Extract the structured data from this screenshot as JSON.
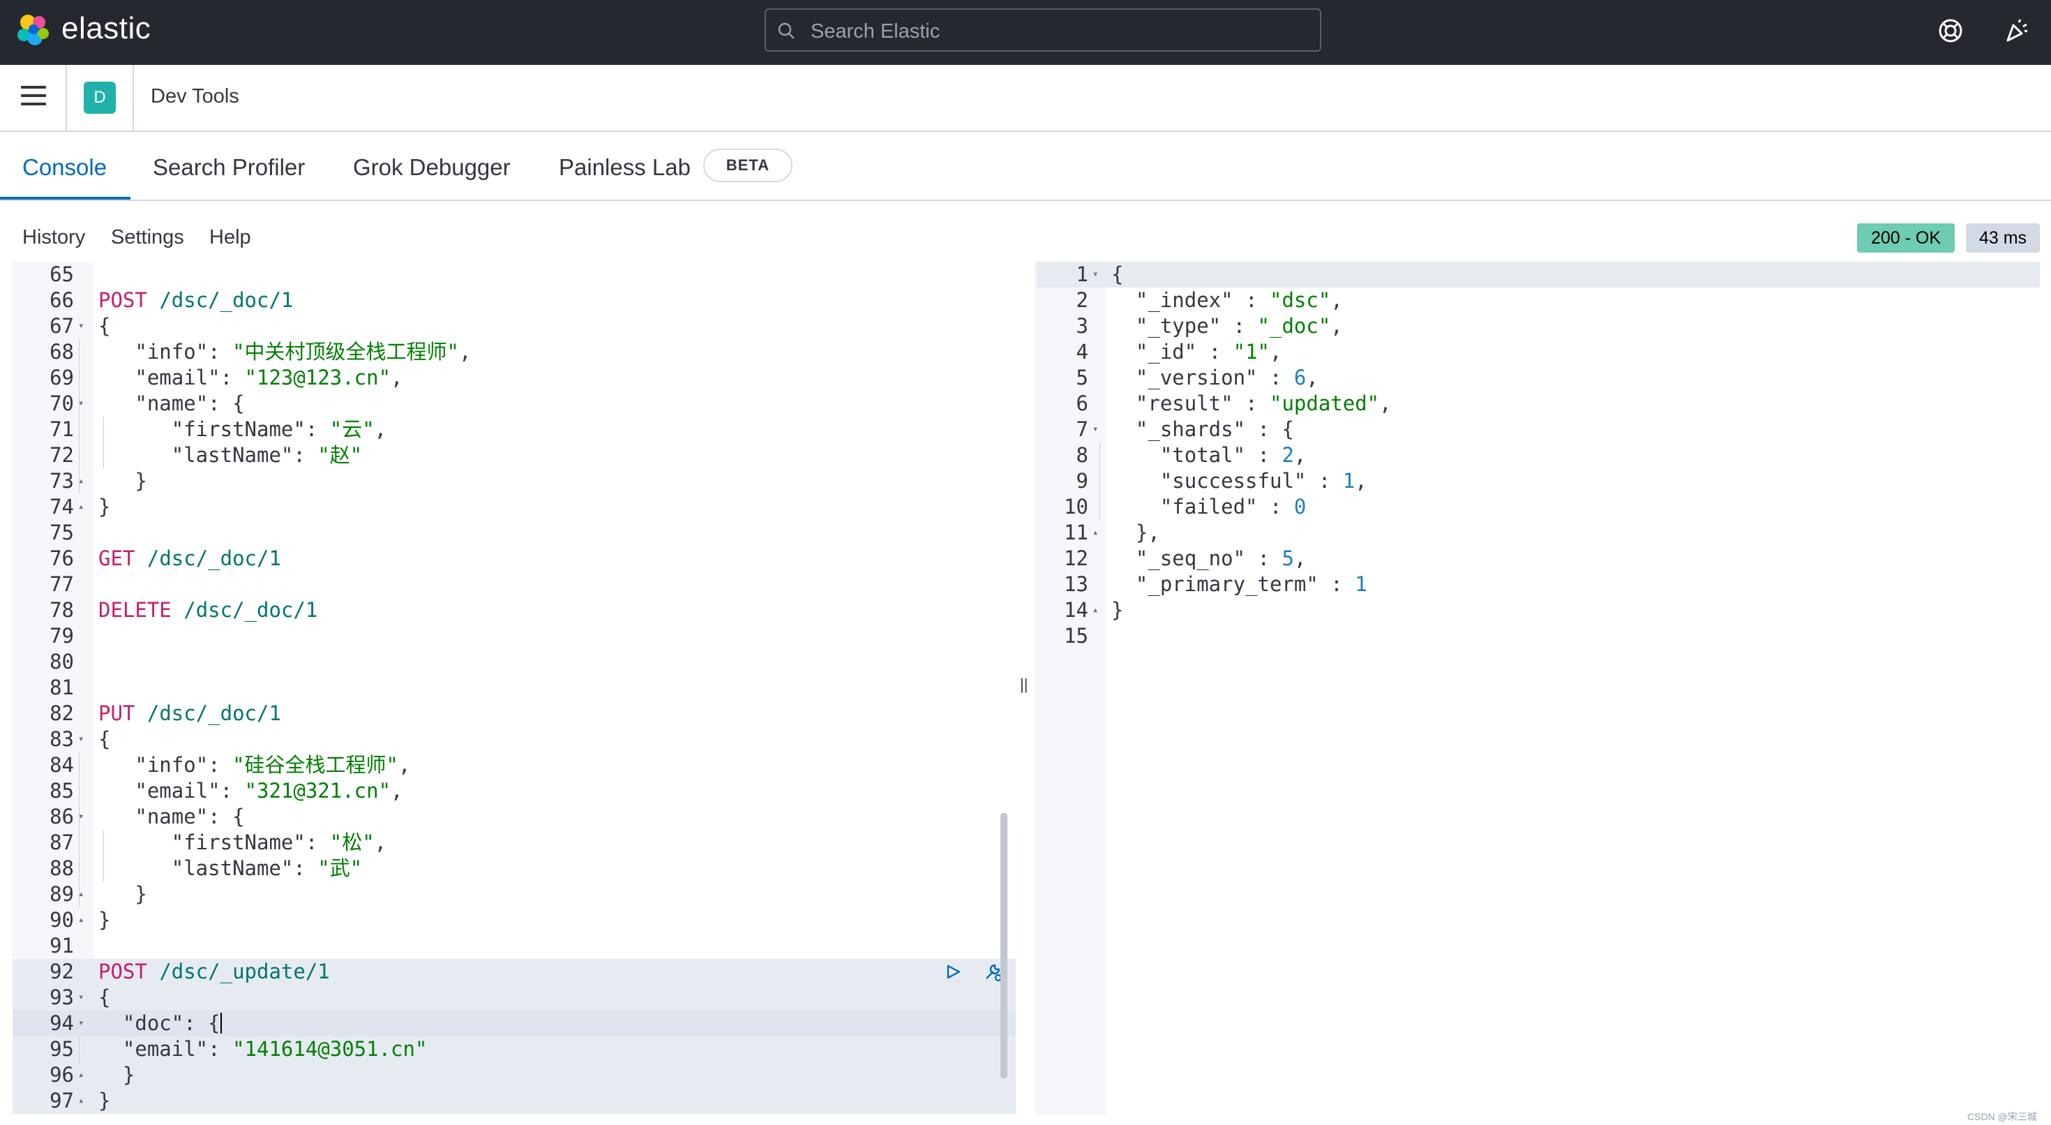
{
  "header": {
    "logo_text": "elastic",
    "search_placeholder": "Search Elastic"
  },
  "breadcrumb": {
    "space_initial": "D",
    "page": "Dev Tools"
  },
  "tabs": [
    {
      "label": "Console",
      "active": true
    },
    {
      "label": "Search Profiler",
      "active": false
    },
    {
      "label": "Grok Debugger",
      "active": false
    },
    {
      "label": "Painless Lab",
      "active": false
    }
  ],
  "beta_badge": "BETA",
  "toolbar": {
    "history": "History",
    "settings": "Settings",
    "help": "Help",
    "status": "200 - OK",
    "time": "43 ms"
  },
  "request_editor": {
    "lines": [
      {
        "n": "65",
        "fold": "",
        "tokens": []
      },
      {
        "n": "66",
        "fold": "",
        "tokens": [
          [
            "m",
            "POST"
          ],
          [
            "d",
            " "
          ],
          [
            "u",
            "/dsc/_doc/1"
          ]
        ]
      },
      {
        "n": "67",
        "fold": "▾",
        "tokens": [
          [
            "d",
            "{"
          ]
        ]
      },
      {
        "n": "68",
        "fold": "",
        "indent": 1,
        "tokens": [
          [
            "k",
            "\"info\""
          ],
          [
            "d",
            ": "
          ],
          [
            "s",
            "\"中关村顶级全栈工程师\""
          ],
          [
            "d",
            ","
          ]
        ]
      },
      {
        "n": "69",
        "fold": "",
        "indent": 1,
        "tokens": [
          [
            "k",
            "\"email\""
          ],
          [
            "d",
            ": "
          ],
          [
            "s",
            "\"123@123.cn\""
          ],
          [
            "d",
            ","
          ]
        ]
      },
      {
        "n": "70",
        "fold": "▾",
        "indent": 1,
        "tokens": [
          [
            "k",
            "\"name\""
          ],
          [
            "d",
            ": {"
          ]
        ]
      },
      {
        "n": "71",
        "fold": "",
        "indent": 2,
        "tokens": [
          [
            "k",
            "\"firstName\""
          ],
          [
            "d",
            ": "
          ],
          [
            "s",
            "\"云\""
          ],
          [
            "d",
            ","
          ]
        ]
      },
      {
        "n": "72",
        "fold": "",
        "indent": 2,
        "tokens": [
          [
            "k",
            "\"lastName\""
          ],
          [
            "d",
            ": "
          ],
          [
            "s",
            "\"赵\""
          ]
        ]
      },
      {
        "n": "73",
        "fold": "▴",
        "indent": 1,
        "tokens": [
          [
            "d",
            "}"
          ]
        ]
      },
      {
        "n": "74",
        "fold": "▴",
        "tokens": [
          [
            "d",
            "}"
          ]
        ]
      },
      {
        "n": "75",
        "fold": "",
        "tokens": []
      },
      {
        "n": "76",
        "fold": "",
        "tokens": [
          [
            "m",
            "GET"
          ],
          [
            "d",
            " "
          ],
          [
            "u",
            "/dsc/_doc/1"
          ]
        ]
      },
      {
        "n": "77",
        "fold": "",
        "tokens": []
      },
      {
        "n": "78",
        "fold": "",
        "tokens": [
          [
            "m",
            "DELETE"
          ],
          [
            "d",
            " "
          ],
          [
            "u",
            "/dsc/_doc/1"
          ]
        ]
      },
      {
        "n": "79",
        "fold": "",
        "tokens": []
      },
      {
        "n": "80",
        "fold": "",
        "tokens": []
      },
      {
        "n": "81",
        "fold": "",
        "tokens": []
      },
      {
        "n": "82",
        "fold": "",
        "tokens": [
          [
            "m",
            "PUT"
          ],
          [
            "d",
            " "
          ],
          [
            "u",
            "/dsc/_doc/1"
          ]
        ]
      },
      {
        "n": "83",
        "fold": "▾",
        "tokens": [
          [
            "d",
            "{"
          ]
        ]
      },
      {
        "n": "84",
        "fold": "",
        "indent": 1,
        "tokens": [
          [
            "k",
            "\"info\""
          ],
          [
            "d",
            ": "
          ],
          [
            "s",
            "\"硅谷全栈工程师\""
          ],
          [
            "d",
            ","
          ]
        ]
      },
      {
        "n": "85",
        "fold": "",
        "indent": 1,
        "tokens": [
          [
            "k",
            "\"email\""
          ],
          [
            "d",
            ": "
          ],
          [
            "s",
            "\"321@321.cn\""
          ],
          [
            "d",
            ","
          ]
        ]
      },
      {
        "n": "86",
        "fold": "▾",
        "indent": 1,
        "tokens": [
          [
            "k",
            "\"name\""
          ],
          [
            "d",
            ": {"
          ]
        ]
      },
      {
        "n": "87",
        "fold": "",
        "indent": 2,
        "tokens": [
          [
            "k",
            "\"firstName\""
          ],
          [
            "d",
            ": "
          ],
          [
            "s",
            "\"松\""
          ],
          [
            "d",
            ","
          ]
        ]
      },
      {
        "n": "88",
        "fold": "",
        "indent": 2,
        "tokens": [
          [
            "k",
            "\"lastName\""
          ],
          [
            "d",
            ": "
          ],
          [
            "s",
            "\"武\""
          ]
        ]
      },
      {
        "n": "89",
        "fold": "▴",
        "indent": 1,
        "tokens": [
          [
            "d",
            "}"
          ]
        ]
      },
      {
        "n": "90",
        "fold": "▴",
        "tokens": [
          [
            "d",
            "}"
          ]
        ]
      },
      {
        "n": "91",
        "fold": "",
        "tokens": []
      },
      {
        "n": "92",
        "fold": "",
        "hl": true,
        "tokens": [
          [
            "m",
            "POST"
          ],
          [
            "d",
            " "
          ],
          [
            "u",
            "/dsc/_update/1"
          ]
        ]
      },
      {
        "n": "93",
        "fold": "▾",
        "hl": true,
        "tokens": [
          [
            "d",
            "{"
          ]
        ]
      },
      {
        "n": "94",
        "fold": "▾",
        "cur": true,
        "tokens": [
          [
            "d",
            "  "
          ],
          [
            "k",
            "\"doc\""
          ],
          [
            "d",
            ": {"
          ]
        ]
      },
      {
        "n": "95",
        "fold": "",
        "hl": true,
        "indent": 1,
        "tokens": [
          [
            "d",
            "  "
          ],
          [
            "k",
            "\"email\""
          ],
          [
            "d",
            ": "
          ],
          [
            "s",
            "\"141614@3051.cn\""
          ]
        ]
      },
      {
        "n": "96",
        "fold": "▴",
        "hl": true,
        "tokens": [
          [
            "d",
            "  }"
          ]
        ]
      },
      {
        "n": "97",
        "fold": "▴",
        "hl": true,
        "tokens": [
          [
            "d",
            "}"
          ]
        ]
      }
    ]
  },
  "response_editor": {
    "lines": [
      {
        "n": "1",
        "fold": "▾",
        "hl": true,
        "tokens": [
          [
            "d",
            "{"
          ]
        ]
      },
      {
        "n": "2",
        "fold": "",
        "tokens": [
          [
            "d",
            "  "
          ],
          [
            "k",
            "\"_index\""
          ],
          [
            "d",
            " : "
          ],
          [
            "s",
            "\"dsc\""
          ],
          [
            "d",
            ","
          ]
        ]
      },
      {
        "n": "3",
        "fold": "",
        "tokens": [
          [
            "d",
            "  "
          ],
          [
            "k",
            "\"_type\""
          ],
          [
            "d",
            " : "
          ],
          [
            "s",
            "\"_doc\""
          ],
          [
            "d",
            ","
          ]
        ]
      },
      {
        "n": "4",
        "fold": "",
        "tokens": [
          [
            "d",
            "  "
          ],
          [
            "k",
            "\"_id\""
          ],
          [
            "d",
            " : "
          ],
          [
            "s",
            "\"1\""
          ],
          [
            "d",
            ","
          ]
        ]
      },
      {
        "n": "5",
        "fold": "",
        "tokens": [
          [
            "d",
            "  "
          ],
          [
            "k",
            "\"_version\""
          ],
          [
            "d",
            " : "
          ],
          [
            "n",
            "6"
          ],
          [
            "d",
            ","
          ]
        ]
      },
      {
        "n": "6",
        "fold": "",
        "tokens": [
          [
            "d",
            "  "
          ],
          [
            "k",
            "\"result\""
          ],
          [
            "d",
            " : "
          ],
          [
            "s",
            "\"updated\""
          ],
          [
            "d",
            ","
          ]
        ]
      },
      {
        "n": "7",
        "fold": "▾",
        "tokens": [
          [
            "d",
            "  "
          ],
          [
            "k",
            "\"_shards\""
          ],
          [
            "d",
            " : {"
          ]
        ]
      },
      {
        "n": "8",
        "fold": "",
        "indent": 1,
        "tokens": [
          [
            "d",
            "    "
          ],
          [
            "k",
            "\"total\""
          ],
          [
            "d",
            " : "
          ],
          [
            "n",
            "2"
          ],
          [
            "d",
            ","
          ]
        ]
      },
      {
        "n": "9",
        "fold": "",
        "indent": 1,
        "tokens": [
          [
            "d",
            "    "
          ],
          [
            "k",
            "\"successful\""
          ],
          [
            "d",
            " : "
          ],
          [
            "n",
            "1"
          ],
          [
            "d",
            ","
          ]
        ]
      },
      {
        "n": "10",
        "fold": "",
        "indent": 1,
        "tokens": [
          [
            "d",
            "    "
          ],
          [
            "k",
            "\"failed\""
          ],
          [
            "d",
            " : "
          ],
          [
            "n",
            "0"
          ]
        ]
      },
      {
        "n": "11",
        "fold": "▴",
        "tokens": [
          [
            "d",
            "  },"
          ]
        ]
      },
      {
        "n": "12",
        "fold": "",
        "tokens": [
          [
            "d",
            "  "
          ],
          [
            "k",
            "\"_seq_no\""
          ],
          [
            "d",
            " : "
          ],
          [
            "n",
            "5"
          ],
          [
            "d",
            ","
          ]
        ]
      },
      {
        "n": "13",
        "fold": "",
        "tokens": [
          [
            "d",
            "  "
          ],
          [
            "k",
            "\"_primary_term\""
          ],
          [
            "d",
            " : "
          ],
          [
            "n",
            "1"
          ]
        ]
      },
      {
        "n": "14",
        "fold": "▴",
        "tokens": [
          [
            "d",
            "}"
          ]
        ]
      },
      {
        "n": "15",
        "fold": "",
        "tokens": []
      }
    ]
  },
  "watermark": "CSDN @宋三城",
  "colors": {
    "header_bg": "#25282f",
    "accent": "#006bb8",
    "status_ok": "#6dccb1",
    "method": "#c61e6b",
    "url": "#00756c",
    "string": "#008000",
    "number": "#1a7fc1"
  }
}
